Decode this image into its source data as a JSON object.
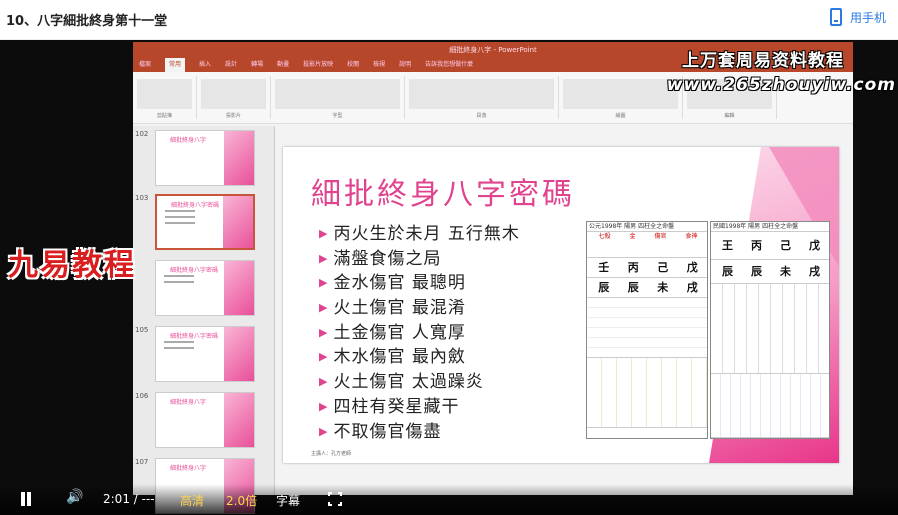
{
  "page": {
    "title": "10、八字細批終身第十一堂"
  },
  "header": {
    "mobile_label": "用手机"
  },
  "ppt": {
    "title": "細批終身八字 - PowerPoint",
    "tabs": [
      "檔案",
      "常用",
      "插入",
      "設計",
      "轉場",
      "動畫",
      "投影片放映",
      "校閱",
      "檢視",
      "說明",
      "告訴我您想做什麼"
    ],
    "ribbon_groups": [
      "剪貼簿",
      "投影片",
      "字型",
      "段落",
      "繪圖",
      "編輯"
    ],
    "thumbnails": [
      {
        "number": "102",
        "title": "細批終身八字"
      },
      {
        "number": "103",
        "title": "細批終身八字密碼"
      },
      {
        "number": "",
        "title": "細批終身八字密碼"
      },
      {
        "number": "105",
        "title": "細批終身八字密碼"
      },
      {
        "number": "106",
        "title": "細批終身八字"
      },
      {
        "number": "107",
        "title": "細批終身八字"
      }
    ]
  },
  "slide": {
    "title": "細批終身八字密碼",
    "bullets": [
      "丙火生於未月 五行無木",
      "滿盤食傷之局",
      "金水傷官 最聰明",
      "火土傷官 最混淆",
      "土金傷官 人寬厚",
      "木水傷官 最內斂",
      "火土傷官 太過躁炎",
      "四柱有癸星藏干",
      "不取傷官傷盡"
    ],
    "footer": "主講人：孔方老師",
    "chart1": {
      "header": "公元1998年 陽男 四柱全之命盤",
      "pillars_top": [
        "七殺",
        "金",
        "傷官",
        "食神"
      ],
      "stems": [
        "壬",
        "丙",
        "己",
        "戊"
      ],
      "branches": [
        "辰",
        "辰",
        "未",
        "戌"
      ]
    },
    "chart2": {
      "header": "民國1998年 陽男 四柱全之命盤",
      "stems": [
        "王",
        "丙",
        "己",
        "戊"
      ],
      "branches": [
        "辰",
        "辰",
        "未",
        "戌"
      ]
    }
  },
  "watermarks": {
    "line1": "上万套周易资料教程",
    "line2": "www.265zhouyiw.com",
    "brand": "九易教程"
  },
  "player": {
    "time": "2:01 / ---",
    "quality": "高清",
    "speed": "2.0倍",
    "subtitles": "字幕"
  }
}
